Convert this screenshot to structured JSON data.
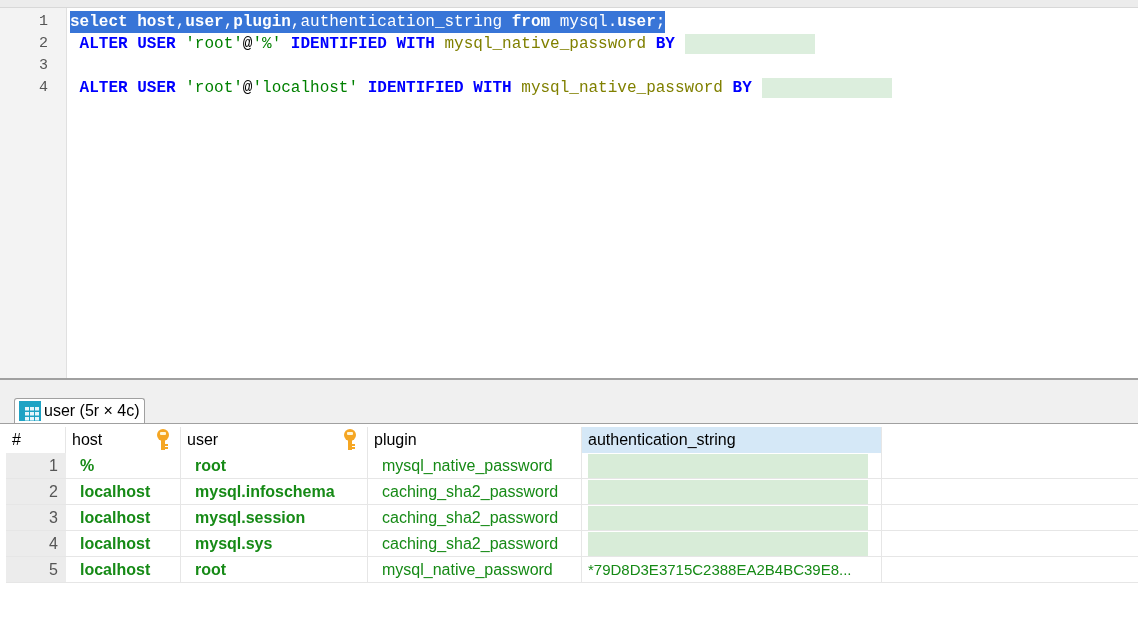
{
  "editor": {
    "lines": [
      {
        "number": "1",
        "selected": true,
        "tokens": [
          {
            "kind": "keyword",
            "text": "select"
          },
          {
            "kind": "keyword",
            "text": " host"
          },
          {
            "kind": "plain",
            "text": ","
          },
          {
            "kind": "keyword",
            "text": "user"
          },
          {
            "kind": "plain",
            "text": ","
          },
          {
            "kind": "keyword",
            "text": "plugin"
          },
          {
            "kind": "plain",
            "text": ",authentication_string"
          },
          {
            "kind": "keyword",
            "text": " from"
          },
          {
            "kind": "plain",
            "text": " mysql."
          },
          {
            "kind": "keyword",
            "text": "user"
          },
          {
            "kind": "plain",
            "text": ";"
          }
        ]
      },
      {
        "number": "2",
        "selected": false,
        "redacted": true,
        "tokens": [
          {
            "kind": "keyword",
            "text": " ALTER USER"
          },
          {
            "kind": "string",
            "text": " 'root'"
          },
          {
            "kind": "plain",
            "text": "@"
          },
          {
            "kind": "string",
            "text": "'%'"
          },
          {
            "kind": "keyword",
            "text": " IDENTIFIED WITH"
          },
          {
            "kind": "identifier",
            "text": " mysql_native_password"
          },
          {
            "kind": "keyword",
            "text": " BY"
          }
        ]
      },
      {
        "number": "3",
        "selected": false,
        "redacted": false
      },
      {
        "number": "4",
        "selected": false,
        "redacted": true,
        "tokens": [
          {
            "kind": "keyword",
            "text": " ALTER USER"
          },
          {
            "kind": "string",
            "text": " 'root'"
          },
          {
            "kind": "plain",
            "text": "@"
          },
          {
            "kind": "string",
            "text": "'localhost'"
          },
          {
            "kind": "keyword",
            "text": " IDENTIFIED WITH"
          },
          {
            "kind": "identifier",
            "text": " mysql_native_password"
          },
          {
            "kind": "keyword",
            "text": " BY"
          }
        ]
      }
    ]
  },
  "results": {
    "tab": {
      "label": "user (5r × 4c)",
      "selected": true
    },
    "columns": [
      {
        "label": "#",
        "key_icon": false,
        "selected": false
      },
      {
        "label": "host",
        "key_icon": true,
        "selected": false
      },
      {
        "label": "user",
        "key_icon": true,
        "selected": false
      },
      {
        "label": "plugin",
        "key_icon": false,
        "selected": false
      },
      {
        "label": "authentication_string",
        "key_icon": false,
        "selected": true
      }
    ],
    "rows": [
      {
        "number": "1",
        "host": "%",
        "user": "root",
        "plugin": "mysql_native_password",
        "redacted": true
      },
      {
        "number": "2",
        "host": "localhost",
        "user": "mysql.infoschema",
        "plugin": "caching_sha2_password",
        "redacted": true
      },
      {
        "number": "3",
        "host": "localhost",
        "user": "mysql.session",
        "plugin": "caching_sha2_password",
        "redacted": true
      },
      {
        "number": "4",
        "host": "localhost",
        "user": "mysql.sys",
        "plugin": "caching_sha2_password",
        "redacted": true
      },
      {
        "number": "5",
        "host": "localhost",
        "user": "root",
        "plugin": "mysql_native_password",
        "auth": "*79D8D3E3715C2388EA2B4BC39E8...",
        "redacted": false
      }
    ]
  }
}
